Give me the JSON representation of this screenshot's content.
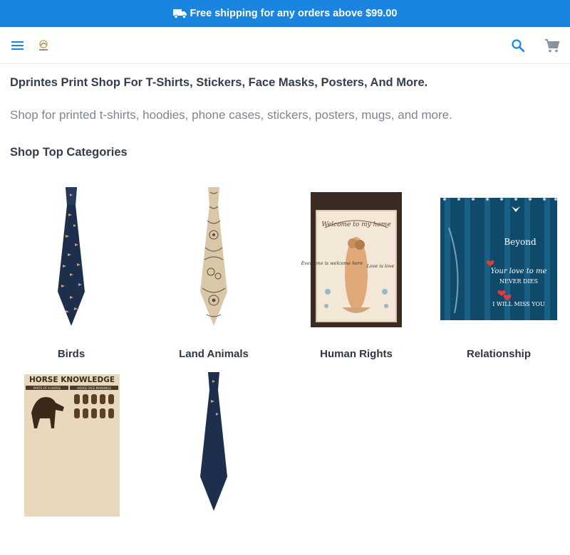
{
  "promo": {
    "icon": "truck-icon",
    "text": "Free shipping for any orders above $99.00",
    "bg_color": "#1a85e0"
  },
  "header": {
    "menu_icon": "hamburger-menu-icon",
    "logo_icon": "dprintes-logo-icon",
    "search_icon": "search-icon",
    "cart_icon": "shopping-cart-icon",
    "accent_color": "#1a85e0"
  },
  "main": {
    "title": "Dprintes Print Shop For T-Shirts, Stickers, Face Masks, Posters, And More.",
    "subtitle": "Shop for printed t-shirts, hoodies, phone cases, stickers, posters, mugs, and more.",
    "categories_heading": "Shop Top Categories",
    "categories": [
      {
        "label": "Birds",
        "image": "navy-tie-with-birds-print"
      },
      {
        "label": "Land Animals",
        "image": "beige-tie-with-tattoo-print"
      },
      {
        "label": "Human Rights",
        "image": "garden-flag-welcome-to-my-home"
      },
      {
        "label": "Relationship",
        "image": "blue-shower-curtain-beyond"
      },
      {
        "label": "",
        "image": "horse-knowledge-poster"
      },
      {
        "label": "",
        "image": "navy-tie-print"
      }
    ]
  },
  "flag_text": {
    "top": "Welcome to my home",
    "left": "Everyone is welcome here",
    "right": "Love is love"
  },
  "curtain_text": {
    "line1": "Beyond",
    "line2": "Your love to me",
    "line3": "NEVER DIES",
    "line4": "I WILL MISS YOU"
  },
  "poster_text": {
    "title": "HORSE KNOWLEDGE",
    "left_header": "PARTS OF A HORSE",
    "right_header": "HORSE FACE MARKINGS"
  }
}
